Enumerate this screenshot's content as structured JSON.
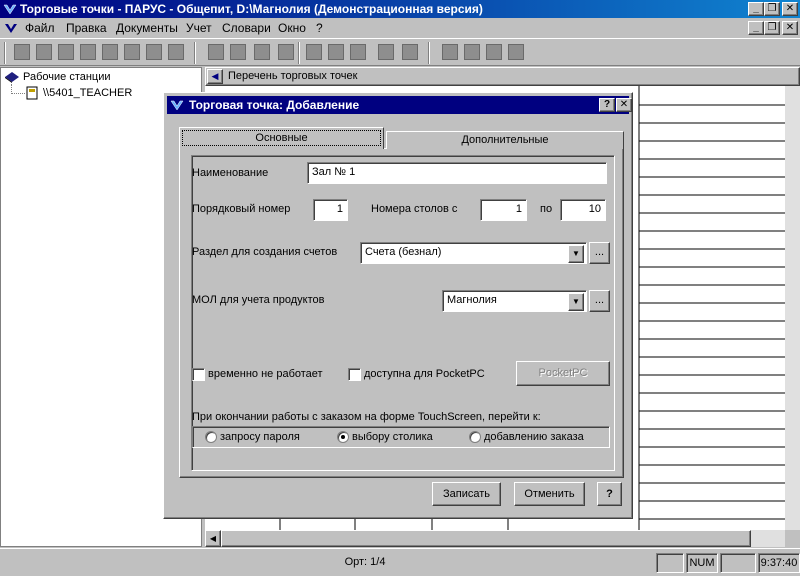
{
  "window": {
    "title": "Торговые точки - ПАРУС - Общепит, D:\\Магнолия (Демонстрационная версия)",
    "minimize": "_",
    "restore": "❐",
    "close": "✕"
  },
  "menu": {
    "items": [
      "Файл",
      "Правка",
      "Документы",
      "Учет",
      "Словари",
      "Окно",
      "?"
    ]
  },
  "toolbar": {
    "icons": [
      "new-doc-icon",
      "copy-doc-icon",
      "edit-doc-icon",
      "delete-icon",
      "filter-icon",
      "print-preview-icon",
      "print-icon",
      "options-icon",
      "screen-icon",
      "users-icon",
      "grid-icon",
      "table-icon",
      "doc-view-icon",
      "brush-icon",
      "calendar-icon",
      "user-card-icon",
      "book-icon",
      "calculator-icon",
      "tools-icon",
      "folder-icon",
      "folder-add-icon"
    ]
  },
  "tree": {
    "root": "Рабочие станции",
    "child": "\\\\5401_TEACHER"
  },
  "right_panel": {
    "header": "Перечень торговых точек",
    "nav_arrow": "◀"
  },
  "statusbar": {
    "record": "Орт: 1/4",
    "num": "NUM",
    "time": "9:37:40"
  },
  "dialog": {
    "title": "Торговая точка: Добавление",
    "help_btn": "?",
    "close_btn": "✕",
    "tabs": [
      "Основные",
      "Дополнительные"
    ],
    "name_label": "Наименование",
    "name_value": "Зал № 1",
    "order_label": "Порядковый номер",
    "order_value": "1",
    "tables_label": "Номера столов  с",
    "tables_from": "1",
    "tables_to_label": "по",
    "tables_to": "10",
    "section_label": "Раздел для создания счетов",
    "section_value": "Счета (безнал)",
    "mol_label": "МОЛ для учета продуктов",
    "mol_value": "Магнолия",
    "browse": "...",
    "chk_inactive": "временно не работает",
    "chk_pocketpc": "доступна для PocketPC",
    "pocketpc_btn": "PocketPC",
    "touch_label": "При окончании работы с заказом на форме TouchScreen, перейти к:",
    "radio_password": "запросу пароля",
    "radio_table": "выбору столика",
    "radio_order": "добавлению заказа",
    "save_btn": "Записать",
    "cancel_btn": "Отменить",
    "help2_btn": "?"
  }
}
